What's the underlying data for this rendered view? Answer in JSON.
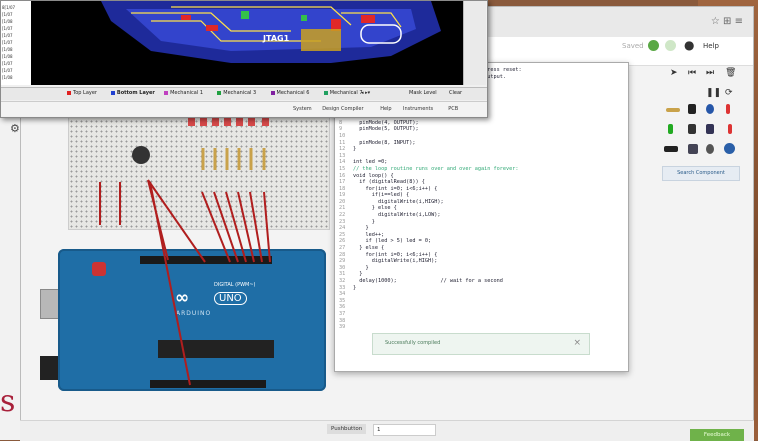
{
  "pcb": {
    "left_list": [
      "8[1/07",
      "[1/07",
      "[1/08",
      "[1/07",
      "[1/07",
      "[1/07",
      "[1/08",
      "[1/08",
      "[1/07",
      "[1/07",
      "[1/08"
    ],
    "board_label": "JTAG1",
    "layer_tabs": [
      {
        "label": "Top Layer",
        "color": "#e02020"
      },
      {
        "label": "Bottom Layer",
        "color": "#2040d0"
      },
      {
        "label": "Mechanical 1",
        "color": "#c040c0"
      },
      {
        "label": "Mechanical 3",
        "color": "#20a040"
      },
      {
        "label": "Mechanical 6",
        "color": "#8020a0"
      },
      {
        "label": "Mechanical 7",
        "color": "#20a060"
      }
    ],
    "tab_more": "◂ ▸▾",
    "mask_level": "Mask Level",
    "clear": "Clear",
    "menu": [
      "System",
      "Design Compiler",
      "Help",
      "Instruments",
      "PCB"
    ]
  },
  "app": {
    "saved_label": "Saved",
    "help_label": "Help",
    "window_icons": "☆ ⊞ ≡"
  },
  "code": {
    "lines": [
      {
        "n": "",
        "t": "                                          press reset:"
      },
      {
        "n": "",
        "t": "                                          output."
      },
      {
        "n": "",
        "t": ""
      },
      {
        "n": "",
        "t": ""
      },
      {
        "n": "",
        "t": ""
      },
      {
        "n": "",
        "t": ""
      },
      {
        "n": "",
        "t": ""
      },
      {
        "n": "",
        "t": ""
      },
      {
        "n": "8",
        "t": "  pinMode(4, OUTPUT);"
      },
      {
        "n": "9",
        "t": "  pinMode(5, OUTPUT);"
      },
      {
        "n": "10",
        "t": ""
      },
      {
        "n": "11",
        "t": "  pinMode(8, INPUT);"
      },
      {
        "n": "12",
        "t": "}"
      },
      {
        "n": "13",
        "t": ""
      },
      {
        "n": "14",
        "t": "int led =0;"
      },
      {
        "n": "15",
        "t": "// the loop routine runs over and over again forever:",
        "c": true
      },
      {
        "n": "16",
        "t": "void loop() {"
      },
      {
        "n": "17",
        "t": "  if (digitalRead(8)) {"
      },
      {
        "n": "18",
        "t": "    for(int i=0; i<6;i++) {"
      },
      {
        "n": "19",
        "t": "      if(i==led) {"
      },
      {
        "n": "20",
        "t": "        digitalWrite(i,HIGH);"
      },
      {
        "n": "21",
        "t": "      } else {"
      },
      {
        "n": "22",
        "t": "        digitalWrite(i,LOW);"
      },
      {
        "n": "23",
        "t": "      }"
      },
      {
        "n": "24",
        "t": "    }"
      },
      {
        "n": "25",
        "t": "    led++;"
      },
      {
        "n": "26",
        "t": "    if (led > 5) led = 0;"
      },
      {
        "n": "27",
        "t": "  } else {"
      },
      {
        "n": "28",
        "t": "    for(int i=0; i<6;i++) {"
      },
      {
        "n": "29",
        "t": "      digitalWrite(i,HIGH);"
      },
      {
        "n": "30",
        "t": "    }"
      },
      {
        "n": "31",
        "t": "  }"
      },
      {
        "n": "32",
        "t": "  delay(1000);              // wait for a second"
      },
      {
        "n": "33",
        "t": "}"
      },
      {
        "n": "34",
        "t": ""
      },
      {
        "n": "35",
        "t": ""
      },
      {
        "n": "36",
        "t": ""
      },
      {
        "n": "37",
        "t": ""
      },
      {
        "n": "38",
        "t": ""
      },
      {
        "n": "39",
        "t": ""
      }
    ]
  },
  "toast": {
    "text": "Successfully compiled",
    "close": "×"
  },
  "components": {
    "search_button": "Search Component"
  },
  "arduino": {
    "uno": "UNO",
    "brand": "ARDUINO",
    "digital_label": "DIGITAL (PWM~)"
  },
  "bottom": {
    "pushbutton_label": "Pushbutton",
    "pushbutton_value": "1",
    "feedback": "Feedback"
  },
  "overlay_letter": "s"
}
